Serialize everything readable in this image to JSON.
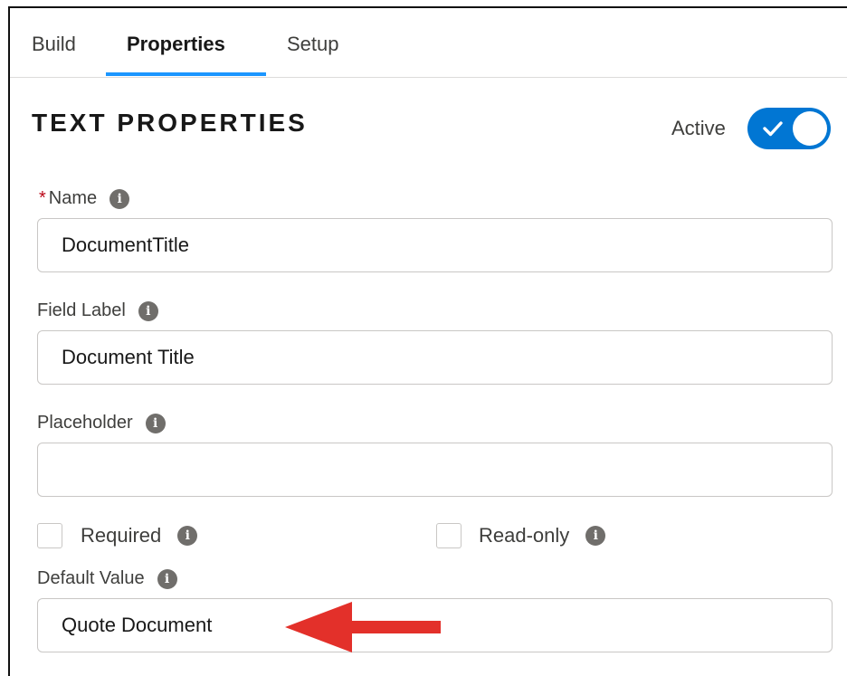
{
  "tabs": [
    {
      "label": "Build"
    },
    {
      "label": "Properties"
    },
    {
      "label": "Setup"
    }
  ],
  "active_tab": "Properties",
  "section": {
    "title": "TEXT PROPERTIES",
    "active_label": "Active",
    "active_toggle_on": true
  },
  "fields": {
    "name": {
      "required_mark": "*",
      "label": "Name",
      "value": "DocumentTitle"
    },
    "field_label": {
      "label": "Field Label",
      "value": "Document Title"
    },
    "placeholder": {
      "label": "Placeholder",
      "value": ""
    },
    "required": {
      "label": "Required",
      "checked": false
    },
    "read_only": {
      "label": "Read-only",
      "checked": false
    },
    "default_value": {
      "label": "Default Value",
      "value": "Quote Document"
    }
  },
  "icons": {
    "info": "info-icon",
    "check": "checkmark-icon",
    "arrow": "red-arrow-left-icon"
  },
  "colors": {
    "accent": "#0176d3",
    "tab_underline": "#1b96ff",
    "required": "#ba0517",
    "annotation_arrow": "#e3302a"
  }
}
